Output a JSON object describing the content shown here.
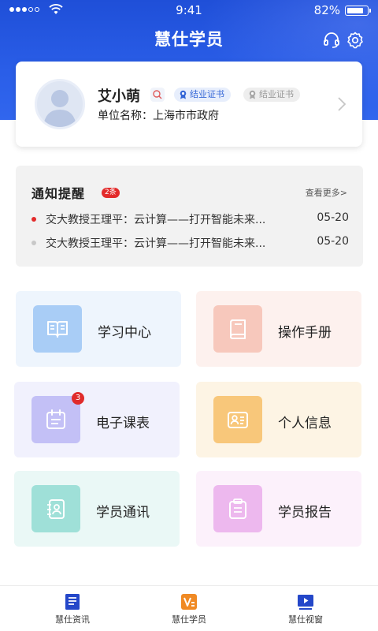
{
  "status_bar": {
    "time": "9:41",
    "battery": "82%",
    "battery_level": 0.82
  },
  "header": {
    "title": "慧仕学员",
    "headset_icon": "headset-icon",
    "settings_icon": "gear-icon"
  },
  "profile": {
    "name": "艾小萌",
    "cert_active": "结业证书",
    "cert_inactive": "结业证书",
    "unit": "单位名称：上海市市政府"
  },
  "notices": {
    "title": "通知提醒",
    "count": "2条",
    "more": "查看更多>",
    "items": [
      {
        "text": "交大教授王理平：云计算——打开智能未来...",
        "date": "05-20",
        "read": false
      },
      {
        "text": "交大教授王理平：云计算——打开智能未来...",
        "date": "05-20",
        "read": true
      }
    ]
  },
  "tiles": [
    {
      "label": "学习中心",
      "icon": "book-open-icon"
    },
    {
      "label": "操作手册",
      "icon": "manual-icon"
    },
    {
      "label": "电子课表",
      "icon": "calendar-icon",
      "badge": "3"
    },
    {
      "label": "个人信息",
      "icon": "id-card-icon"
    },
    {
      "label": "学员通讯",
      "icon": "contacts-icon"
    },
    {
      "label": "学员报告",
      "icon": "clipboard-icon"
    }
  ],
  "tabbar": [
    {
      "label": "慧仕资讯",
      "icon": "news-icon"
    },
    {
      "label": "慧仕学员",
      "icon": "student-icon"
    },
    {
      "label": "慧仕视窗",
      "icon": "video-icon"
    }
  ],
  "colors": {
    "brand_blue": "#2457e0",
    "unread_dot": "#e32b2b",
    "read_dot": "#c8c8c8",
    "badge_red": "#e02b2b"
  }
}
